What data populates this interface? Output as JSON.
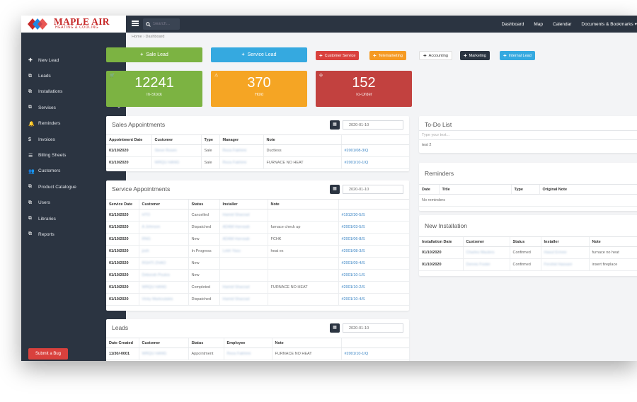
{
  "brand": {
    "name": "MAPLE AIR",
    "tagline": "HEATING & COOLING"
  },
  "search": {
    "placeholder": "Search..."
  },
  "topnav": [
    "Dashboard",
    "Map",
    "Calendar",
    "Documents & Bookmarks"
  ],
  "breadcrumb": "Home  ›  Dashboard",
  "sidebar": [
    {
      "label": "New Lead",
      "icon": "plus-icon",
      "chevron": false
    },
    {
      "label": "Leads",
      "icon": "copy-icon",
      "chevron": true
    },
    {
      "label": "Installations",
      "icon": "copy-icon",
      "chevron": true
    },
    {
      "label": "Services",
      "icon": "copy-icon",
      "chevron": true
    },
    {
      "label": "Reminders",
      "icon": "bell-icon",
      "chevron": false
    },
    {
      "label": "Invoices",
      "icon": "dollar-icon",
      "chevron": false
    },
    {
      "label": "Billing Sheets",
      "icon": "list-icon",
      "chevron": false
    },
    {
      "label": "Customers",
      "icon": "users-icon",
      "chevron": false
    },
    {
      "label": "Product Catalogue",
      "icon": "copy-icon",
      "chevron": true
    },
    {
      "label": "Users",
      "icon": "copy-icon",
      "chevron": true
    },
    {
      "label": "Libraries",
      "icon": "copy-icon",
      "chevron": true
    },
    {
      "label": "Reports",
      "icon": "copy-icon",
      "chevron": true
    }
  ],
  "submit_bug": "Submit a Bug",
  "actions": {
    "sale_lead": "Sale Lead",
    "service_lead": "Service Lead",
    "small": [
      {
        "label": "Customer Service",
        "color": "#d9413d",
        "text": "#fff"
      },
      {
        "label": "Telemarketing",
        "color": "#f59a23",
        "text": "#fff"
      },
      {
        "label": "Accounting",
        "color": "#ffffff",
        "text": "#333"
      },
      {
        "label": "Marketing",
        "color": "#2b3441",
        "text": "#fff"
      },
      {
        "label": "Internal Lead",
        "color": "#35a9e0",
        "text": "#fff"
      }
    ]
  },
  "stats": [
    {
      "value": "12241",
      "label": "In-Stock",
      "color": "#7cb342",
      "icon": "cart-icon"
    },
    {
      "value": "370",
      "label": "Hold",
      "color": "#f5a524",
      "icon": "warning-icon"
    },
    {
      "value": "152",
      "label": "To-Order",
      "color": "#c2413f",
      "icon": "minus-circle-icon"
    }
  ],
  "sales": {
    "title": "Sales Appointments",
    "date": "2020-01-10",
    "headers": [
      "Appointment Date",
      "Customer",
      "Type",
      "Manager",
      "Note",
      ""
    ],
    "rows": [
      [
        "01/10/2020",
        "Steve Rosen",
        "Sale",
        "Reza Fakhimi",
        "Ductless",
        "#2001/08-3/Q"
      ],
      [
        "01/10/2020",
        "WRQU HANG",
        "Sale",
        "Reza Fakhimi",
        "FURNACE NO HEAT",
        "#2001/10-1/Q"
      ]
    ]
  },
  "service": {
    "title": "Service Appointments",
    "date": "2020-01-10",
    "headers": [
      "Service Date",
      "Customer",
      "Status",
      "Installer",
      "Note",
      ""
    ],
    "rows": [
      [
        "01/10/2020",
        "HTO",
        "Cancelled",
        "Hamid Sharzad",
        "",
        "#1912/30-5/S"
      ],
      [
        "01/10/2020",
        "A Johnson",
        "Dispatched",
        "ADAM Harvaab",
        "furnace check up",
        "#2001/03-5/S"
      ],
      [
        "01/10/2020",
        "RNG",
        "New",
        "ADAM Harvaab",
        "FCHK",
        "#2001/06-8/S"
      ],
      [
        "01/10/2020",
        "josh",
        "In Progress",
        "Lekh Yasu",
        "heat ex",
        "#2001/08-3/S"
      ],
      [
        "01/10/2020",
        "RGHTI ZHAO",
        "New",
        "",
        "",
        "#2001/09-4/S"
      ],
      [
        "01/10/2020",
        "Deborah Poulos",
        "New",
        "",
        "",
        "#2001/10-1/S"
      ],
      [
        "01/10/2020",
        "WRQU HANG",
        "Completed",
        "Hamid Sharzad",
        "FURNACE NO HEAT",
        "#2001/10-2/S"
      ],
      [
        "01/10/2020",
        "Vicky Markoulakis",
        "Dispatched",
        "Hamid Sharzad",
        "",
        "#2001/10-4/S"
      ]
    ]
  },
  "leads": {
    "title": "Leads",
    "date": "2020-01-10",
    "headers": [
      "Date Created",
      "Customer",
      "Status",
      "Employee",
      "Note",
      ""
    ],
    "rows": [
      [
        "11/30/-0001",
        "WRQU HANG",
        "Appointment",
        "Reza Fakhimi",
        "FURNACE NO HEAT",
        "#2001/10-1/Q"
      ]
    ]
  },
  "todo": {
    "title": "To-Do List",
    "placeholder": "Type your text...",
    "items": [
      "test 2"
    ]
  },
  "reminders": {
    "title": "Reminders",
    "headers": [
      "Date",
      "Title",
      "Type",
      "Original Note"
    ],
    "empty": "No reminders"
  },
  "installation": {
    "title": "New Installation",
    "headers": [
      "Installation Date",
      "Customer",
      "Status",
      "Installer",
      "Note"
    ],
    "rows": [
      [
        "01/10/2020",
        "Charles Maulers",
        "Confirmed",
        "Hasut Ermee",
        "furnace no heat"
      ],
      [
        "01/10/2020",
        "Dennis Foster",
        "Confirmed",
        "Fershid Hassani",
        "insert fireplace"
      ]
    ]
  }
}
